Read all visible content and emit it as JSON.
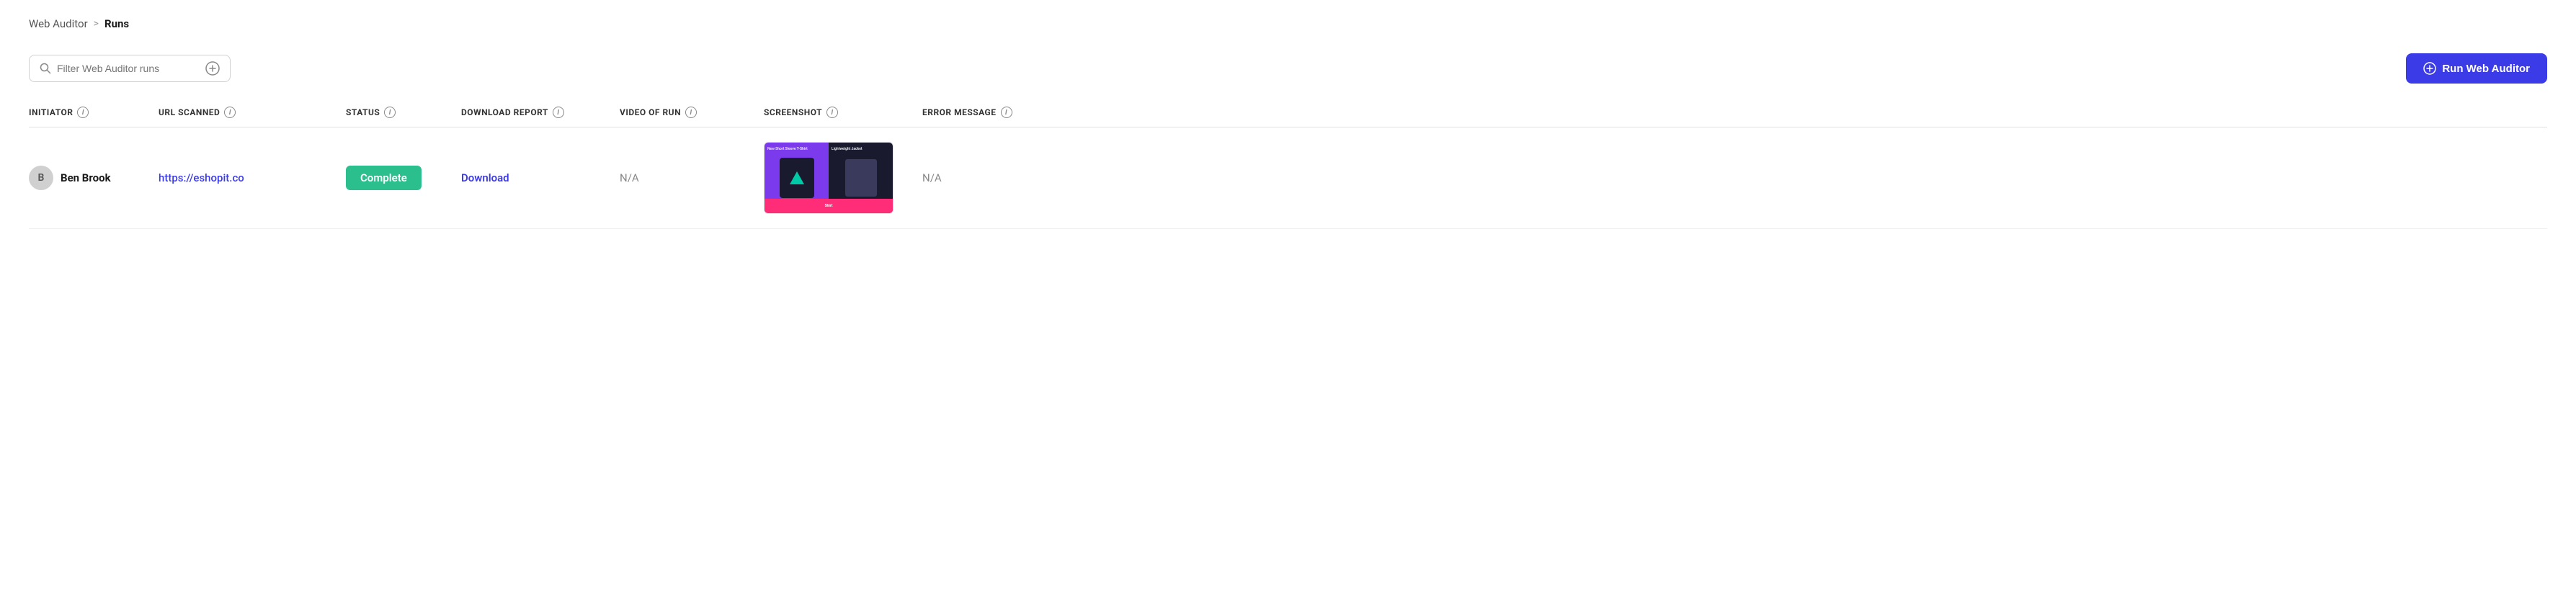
{
  "breadcrumb": {
    "parent": "Web Auditor",
    "separator": ">",
    "current": "Runs"
  },
  "toolbar": {
    "filter_placeholder": "Filter Web Auditor runs",
    "run_button_label": "Run Web Auditor"
  },
  "table": {
    "columns": [
      {
        "id": "initiator",
        "label": "INITIATOR"
      },
      {
        "id": "url_scanned",
        "label": "URL SCANNED"
      },
      {
        "id": "status",
        "label": "STATUS"
      },
      {
        "id": "download_report",
        "label": "DOWNLOAD REPORT"
      },
      {
        "id": "video_of_run",
        "label": "VIDEO OF RUN"
      },
      {
        "id": "screenshot",
        "label": "SCREENSHOT"
      },
      {
        "id": "error_message",
        "label": "ERROR MESSAGE"
      }
    ],
    "rows": [
      {
        "initiator_initial": "B",
        "initiator_name": "Ben Brook",
        "url": "https://eshopit.co",
        "status": "Complete",
        "download_label": "Download",
        "video": "N/A",
        "screenshot_alt": "Screenshot of eshopit.co",
        "error": "N/A",
        "screenshot_left_label": "New Short Sleeve T-Shirt",
        "screenshot_right_label": "Lightweight Jacket",
        "screenshot_bottom_label": "Shirt"
      }
    ]
  }
}
